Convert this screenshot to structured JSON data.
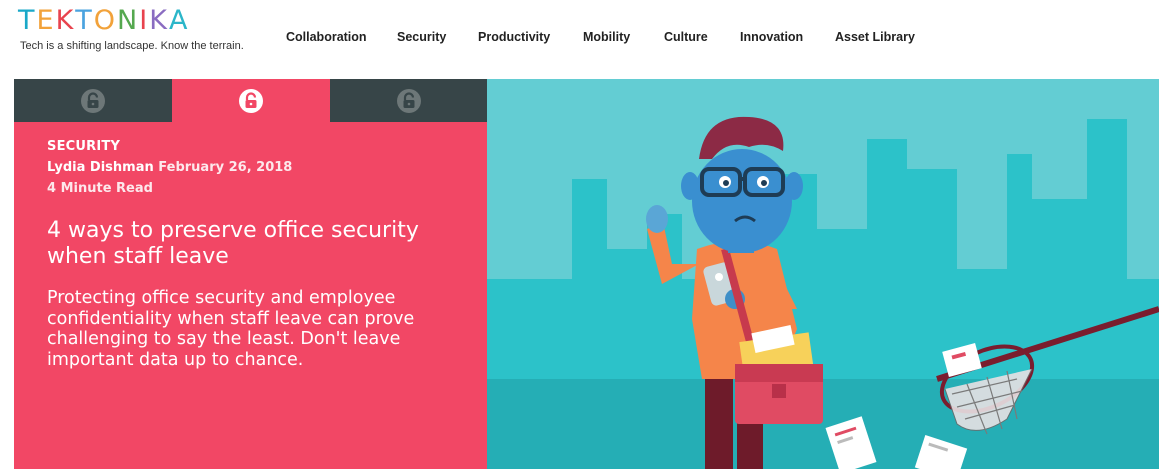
{
  "brand": {
    "letters": [
      "T",
      "E",
      "K",
      "T",
      "O",
      "N",
      "I",
      "K",
      "A"
    ],
    "letter_colors": [
      "#1aa8c8",
      "#f2a23a",
      "#e8434e",
      "#4aa3df",
      "#f2a23a",
      "#55a84f",
      "#e8434e",
      "#8a6cc1",
      "#2bb6c9"
    ],
    "tagline": "Tech is a shifting landscape. Know the terrain."
  },
  "nav": {
    "items": [
      {
        "label": "Collaboration"
      },
      {
        "label": "Security"
      },
      {
        "label": "Productivity"
      },
      {
        "label": "Mobility"
      },
      {
        "label": "Culture"
      },
      {
        "label": "Innovation"
      },
      {
        "label": "Asset Library"
      }
    ]
  },
  "tabs": [
    {
      "icon": "lock-icon",
      "state": "inactive"
    },
    {
      "icon": "lock-icon",
      "state": "active"
    },
    {
      "icon": "lock-icon",
      "state": "inactive"
    }
  ],
  "article": {
    "category": "SECURITY",
    "author": "Lydia Dishman",
    "date": "February 26, 2018",
    "read_time": "4 Minute Read",
    "title": "4 ways to preserve office security when staff leave",
    "description": "Protecting office security and employee confidentiality when staff leave can prove challenging to say the least. Don't leave important data up to chance."
  },
  "colors": {
    "accent_pink": "#f24765",
    "tab_dark": "#374548",
    "hero_bg": "#2cc2c9",
    "hero_buildings": "#63cdd3"
  },
  "hero": {
    "icon": "man-with-briefcase-illustration"
  }
}
